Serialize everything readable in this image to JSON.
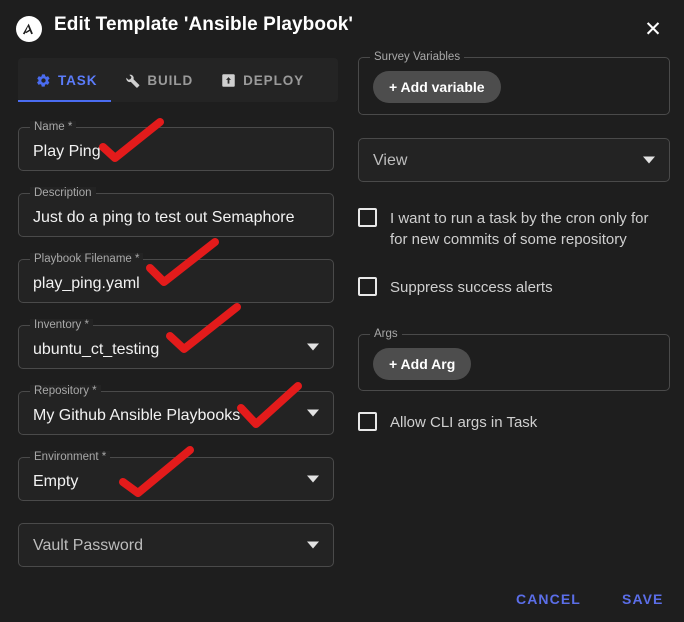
{
  "header": {
    "logo_icon": "ansible-logo-icon",
    "title": "Edit Template 'Ansible Playbook'",
    "close_icon": "close-icon"
  },
  "tabs": [
    {
      "label": "TASK",
      "icon": "gear-icon",
      "active": true
    },
    {
      "label": "BUILD",
      "icon": "wrench-icon",
      "active": false
    },
    {
      "label": "DEPLOY",
      "icon": "deploy-icon",
      "active": false
    }
  ],
  "left_form": {
    "name": {
      "legend": "Name *",
      "value": "Play Ping"
    },
    "description": {
      "legend": "Description",
      "value": "Just do a ping to test out Semaphore"
    },
    "playbook": {
      "legend": "Playbook Filename *",
      "value": "play_ping.yaml"
    },
    "inventory": {
      "legend": "Inventory *",
      "value": "ubuntu_ct_testing"
    },
    "repository": {
      "legend": "Repository *",
      "value": "My Github Ansible Playbooks"
    },
    "environment": {
      "legend": "Environment *",
      "value": "Empty"
    },
    "vault": {
      "legend": "",
      "value": "Vault Password"
    }
  },
  "right_form": {
    "survey": {
      "legend": "Survey Variables",
      "add_label": "+ Add variable"
    },
    "view": {
      "value": "View"
    },
    "cron_checkbox": {
      "label": "I want to run a task by the cron only for for new commits of some repository",
      "checked": false
    },
    "suppress_checkbox": {
      "label": "Suppress success alerts",
      "checked": false
    },
    "args": {
      "legend": "Args",
      "add_label": "+ Add Arg"
    },
    "cli_checkbox": {
      "label": "Allow CLI args in Task",
      "checked": false
    }
  },
  "footer": {
    "cancel_label": "CANCEL",
    "save_label": "SAVE"
  },
  "colors": {
    "background": "#1e1e1e",
    "field_bg": "#232323",
    "border": "#4a4a4a",
    "accent_blue": "#5b6ee8",
    "tab_active": "#5b7cfa",
    "annotation_red": "#e31b1b",
    "pill_grey": "#4d4d4d"
  },
  "annotations": [
    {
      "name": "name-checkmark",
      "target": "Name"
    },
    {
      "name": "playbook-checkmark",
      "target": "Playbook Filename"
    },
    {
      "name": "inventory-checkmark",
      "target": "Inventory"
    },
    {
      "name": "repository-checkmark",
      "target": "Repository"
    },
    {
      "name": "environment-checkmark",
      "target": "Environment"
    }
  ]
}
